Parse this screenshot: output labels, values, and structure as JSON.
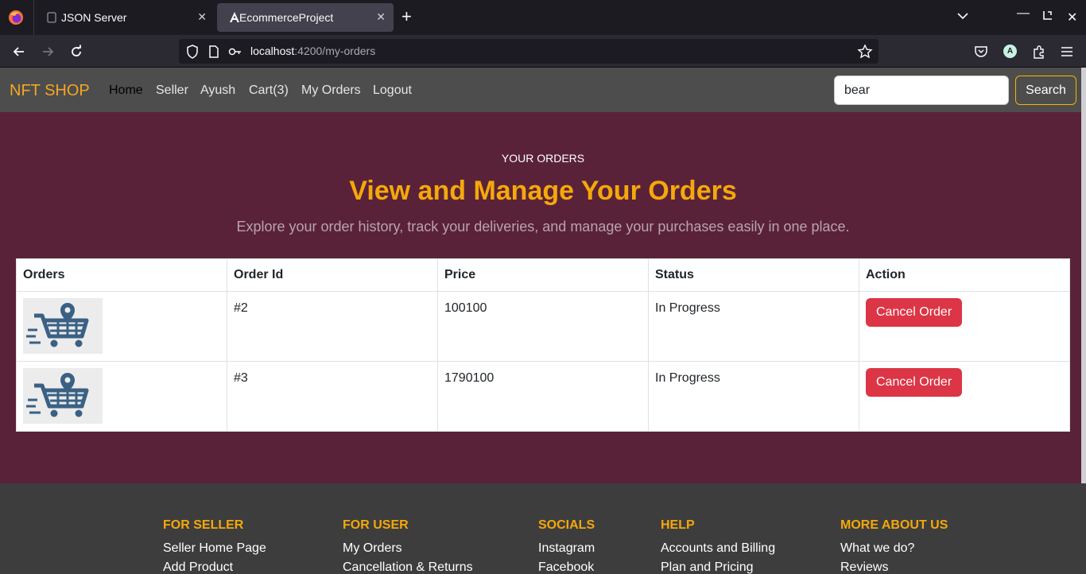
{
  "browser": {
    "tabs": [
      {
        "title": "JSON Server",
        "active": false
      },
      {
        "title": "EcommerceProject",
        "active": true
      }
    ],
    "url_host": "localhost",
    "url_path": ":4200/my-orders",
    "account_initial": "A",
    "colors": {
      "chrome": "#1c1b22",
      "toolbar": "#2b2a33",
      "active_tab": "#42414d"
    }
  },
  "app": {
    "brand": "NFT SHOP",
    "nav": [
      "Home",
      "Seller",
      "Ayush",
      "Cart(3)",
      "My Orders",
      "Logout"
    ],
    "search_value": "bear",
    "search_button": "Search",
    "colors": {
      "accent": "#f5a80a",
      "page_bg": "#5a2239",
      "nav_bg": "#4d4d4d",
      "danger": "#dc3545"
    }
  },
  "hero": {
    "eyebrow": "YOUR ORDERS",
    "title": "View and Manage Your Orders",
    "subtitle": "Explore your order history, track your deliveries, and manage your purchases easily in one place."
  },
  "orders_table": {
    "headers": [
      "Orders",
      "Order Id",
      "Price",
      "Status",
      "Action"
    ],
    "rows": [
      {
        "image_icon": "shopping-cart-location-icon",
        "order_id": "#2",
        "price": "100100",
        "status": "In Progress",
        "action": "Cancel Order"
      },
      {
        "image_icon": "shopping-cart-location-icon",
        "order_id": "#3",
        "price": "1790100",
        "status": "In Progress",
        "action": "Cancel Order"
      }
    ]
  },
  "footer": {
    "columns": [
      {
        "title": "FOR SELLER",
        "links": [
          "Seller Home Page",
          "Add Product"
        ]
      },
      {
        "title": "FOR USER",
        "links": [
          "My Orders",
          "Cancellation & Returns"
        ]
      },
      {
        "title": "SOCIALS",
        "links": [
          "Instagram",
          "Facebook"
        ]
      },
      {
        "title": "HELP",
        "links": [
          "Accounts and Billing",
          "Plan and Pricing"
        ]
      },
      {
        "title": "MORE ABOUT US",
        "links": [
          "What we do?",
          "Reviews"
        ]
      }
    ]
  }
}
